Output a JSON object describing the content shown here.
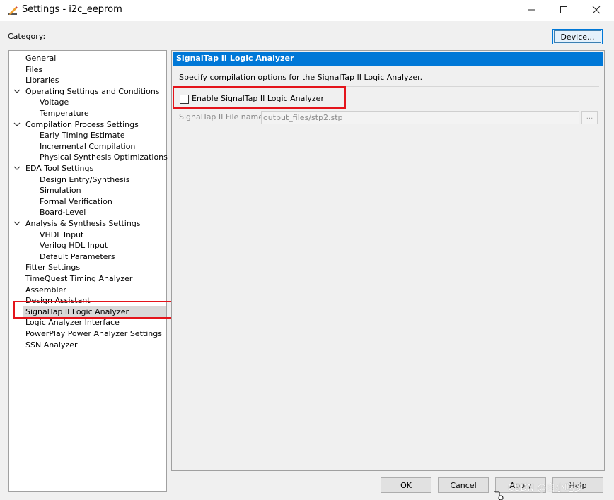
{
  "window": {
    "title": "Settings - i2c_eeprom",
    "controls": {
      "minimize_icon": "minimize-icon",
      "maximize_icon": "maximize-icon",
      "close_icon": "close-icon"
    }
  },
  "category_label": "Category:",
  "device_button": "Device...",
  "tree": {
    "items": [
      {
        "label": "General",
        "level": 0
      },
      {
        "label": "Files",
        "level": 0
      },
      {
        "label": "Libraries",
        "level": 0
      },
      {
        "label": "Operating Settings and Conditions",
        "level": 0,
        "expanded": true
      },
      {
        "label": "Voltage",
        "level": 1
      },
      {
        "label": "Temperature",
        "level": 1
      },
      {
        "label": "Compilation Process Settings",
        "level": 0,
        "expanded": true
      },
      {
        "label": "Early Timing Estimate",
        "level": 1
      },
      {
        "label": "Incremental Compilation",
        "level": 1
      },
      {
        "label": "Physical Synthesis Optimizations",
        "level": 1
      },
      {
        "label": "EDA Tool Settings",
        "level": 0,
        "expanded": true
      },
      {
        "label": "Design Entry/Synthesis",
        "level": 1
      },
      {
        "label": "Simulation",
        "level": 1
      },
      {
        "label": "Formal Verification",
        "level": 1
      },
      {
        "label": "Board-Level",
        "level": 1
      },
      {
        "label": "Analysis & Synthesis Settings",
        "level": 0,
        "expanded": true
      },
      {
        "label": "VHDL Input",
        "level": 1
      },
      {
        "label": "Verilog HDL Input",
        "level": 1
      },
      {
        "label": "Default Parameters",
        "level": 1
      },
      {
        "label": "Fitter Settings",
        "level": 0
      },
      {
        "label": "TimeQuest Timing Analyzer",
        "level": 0
      },
      {
        "label": "Assembler",
        "level": 0
      },
      {
        "label": "Design Assistant",
        "level": 0
      },
      {
        "label": "SignalTap II Logic Analyzer",
        "level": 0,
        "selected": true
      },
      {
        "label": "Logic Analyzer Interface",
        "level": 0
      },
      {
        "label": "PowerPlay Power Analyzer Settings",
        "level": 0
      },
      {
        "label": "SSN Analyzer",
        "level": 0
      }
    ]
  },
  "panel": {
    "header": "SignalTap II Logic Analyzer",
    "description": "Specify compilation options for the SignalTap II Logic Analyzer.",
    "enable_checkbox": {
      "label": "Enable SignalTap II Logic Analyzer",
      "checked": false
    },
    "file_name": {
      "label": "SignalTap II File name:",
      "value": "output_files/stp2.stp",
      "browse_label": "..."
    }
  },
  "footer": {
    "ok": "OK",
    "cancel": "Cancel",
    "apply": "Apply",
    "help": "Help"
  },
  "watermark": "CSDN @自小吃多",
  "colors": {
    "accent": "#0078d7",
    "highlight_box": "#e4141b",
    "selected_bg": "#d9d9d9"
  }
}
